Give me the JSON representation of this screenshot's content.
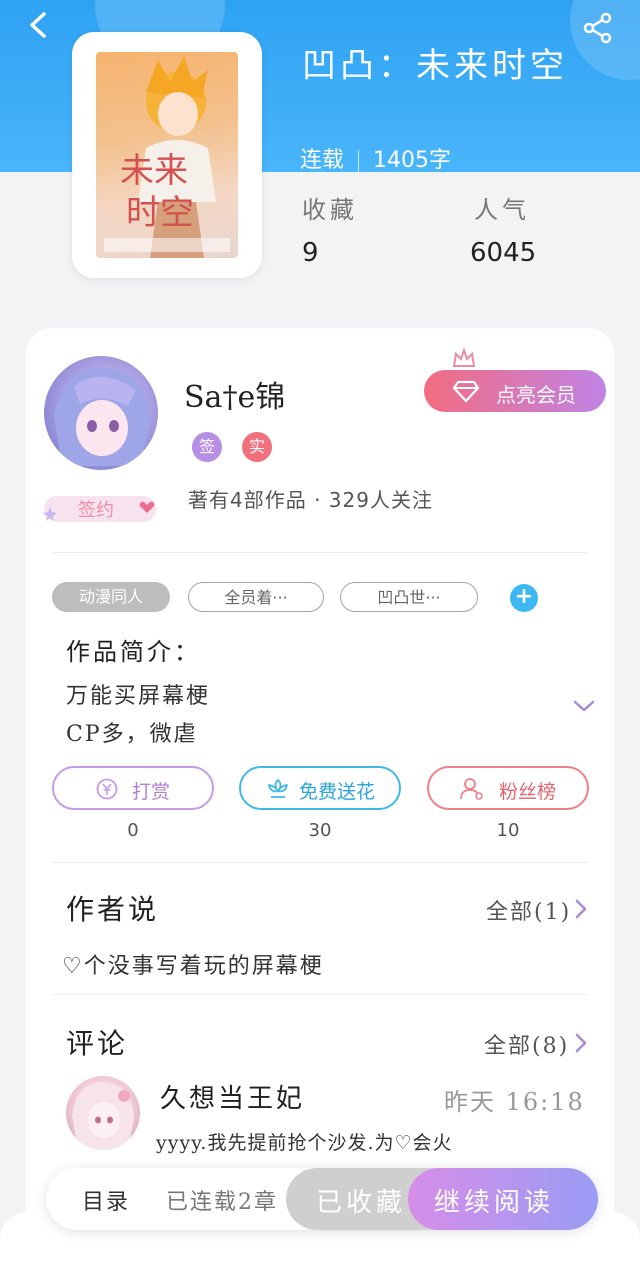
{
  "book": {
    "title": "凹凸：未来时空",
    "status": "连载",
    "word_count": "1405字",
    "stats": {
      "favorites_label": "收藏",
      "favorites_value": "9",
      "popularity_label": "人气",
      "popularity_value": "6045"
    }
  },
  "author": {
    "name": "Sa†e锦",
    "badges": [
      "签",
      "实"
    ],
    "sign_badge": "签约",
    "info": "著有4部作品 · 329人关注",
    "vip_button": "点亮会员"
  },
  "tags": [
    "动漫同人",
    "全员着···",
    "凹凸世···"
  ],
  "intro": {
    "heading": "作品简介：",
    "lines": [
      "万能买屏幕梗",
      "CP多，微虐"
    ]
  },
  "actions": [
    {
      "label": "打赏",
      "count": "0",
      "color": "#c79ae6"
    },
    {
      "label": "免费送花",
      "count": "30",
      "color": "#3fb8e8"
    },
    {
      "label": "粉丝榜",
      "count": "10",
      "color": "#ef7f86"
    }
  ],
  "author_said": {
    "heading": "作者说",
    "more": "全部(1)",
    "text": "♡个没事写着玩的屏幕梗"
  },
  "comments": {
    "heading": "评论",
    "more": "全部(8)",
    "items": [
      {
        "name": "久想当王妃",
        "time": "昨天 16:18",
        "text": "yyyy.我先提前抢个沙发.为♡会火"
      }
    ]
  },
  "bottom_bar": {
    "toc": "目录",
    "status": "已连载2章",
    "favorite": "已收藏",
    "read": "继续阅读"
  },
  "colors": {
    "header": "#2ea2f2",
    "accent_blue": "#3db8f5",
    "vip_gradient_start": "#f26c80",
    "vip_gradient_end": "#c083e6"
  }
}
